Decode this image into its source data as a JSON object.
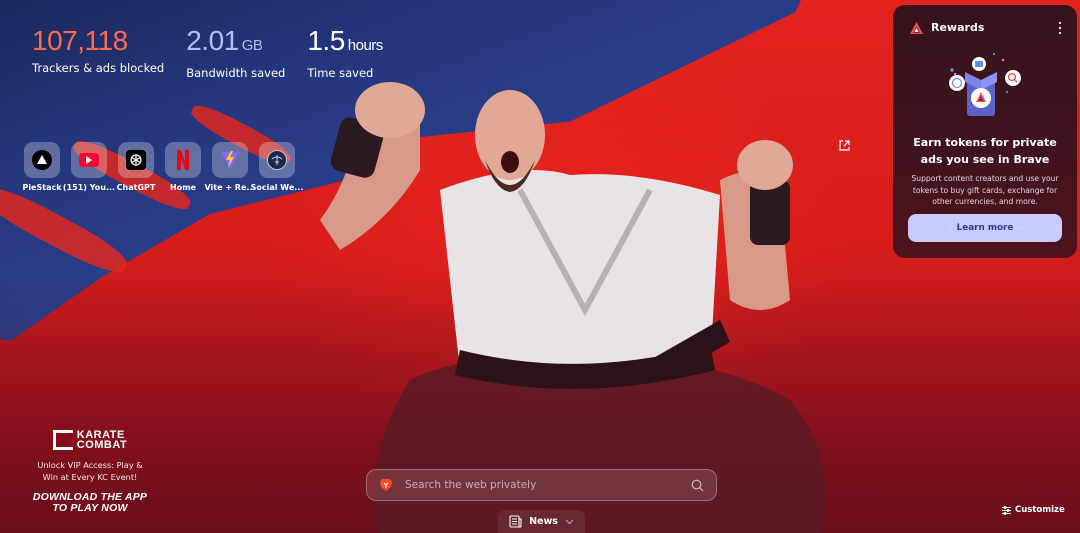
{
  "stats": {
    "trackers": {
      "value": "107,118",
      "unit": "",
      "label": "Trackers & ads blocked"
    },
    "bandwidth": {
      "value": "2.01",
      "unit": "GB",
      "label": "Bandwidth saved"
    },
    "time": {
      "value": "1.5",
      "unit": "hours",
      "label": "Time saved"
    }
  },
  "top_sites": [
    {
      "name": "PieStack",
      "icon": "piestack-icon"
    },
    {
      "name": "(151) You...",
      "icon": "youtube-icon"
    },
    {
      "name": "ChatGPT",
      "icon": "chatgpt-icon"
    },
    {
      "name": "Home",
      "icon": "netflix-icon"
    },
    {
      "name": "Vite + Re...",
      "icon": "vite-icon"
    },
    {
      "name": "Social We...",
      "icon": "globe-icon"
    }
  ],
  "rewards": {
    "title": "Rewards",
    "heading": "Earn tokens for private ads you see in Brave",
    "body": "Support content creators and use your tokens to buy gift cards, exchange for other currencies, and more.",
    "button": "Learn more"
  },
  "sponsor": {
    "brand_line1": "KARATE",
    "brand_line2": "COMBAT",
    "tagline": "Unlock VIP Access: Play & Win at Every KC Event!",
    "cta_line1": "DOWNLOAD THE APP",
    "cta_line2": "TO PLAY NOW"
  },
  "search": {
    "placeholder": "Search the web privately",
    "value": ""
  },
  "news": {
    "label": "News"
  },
  "customize": {
    "label": "Customize"
  },
  "colors": {
    "trackers": "#ff6b4a",
    "bandwidth": "#b9bdf5",
    "button_bg": "#c8cbff",
    "button_text": "#2d3a8c"
  }
}
